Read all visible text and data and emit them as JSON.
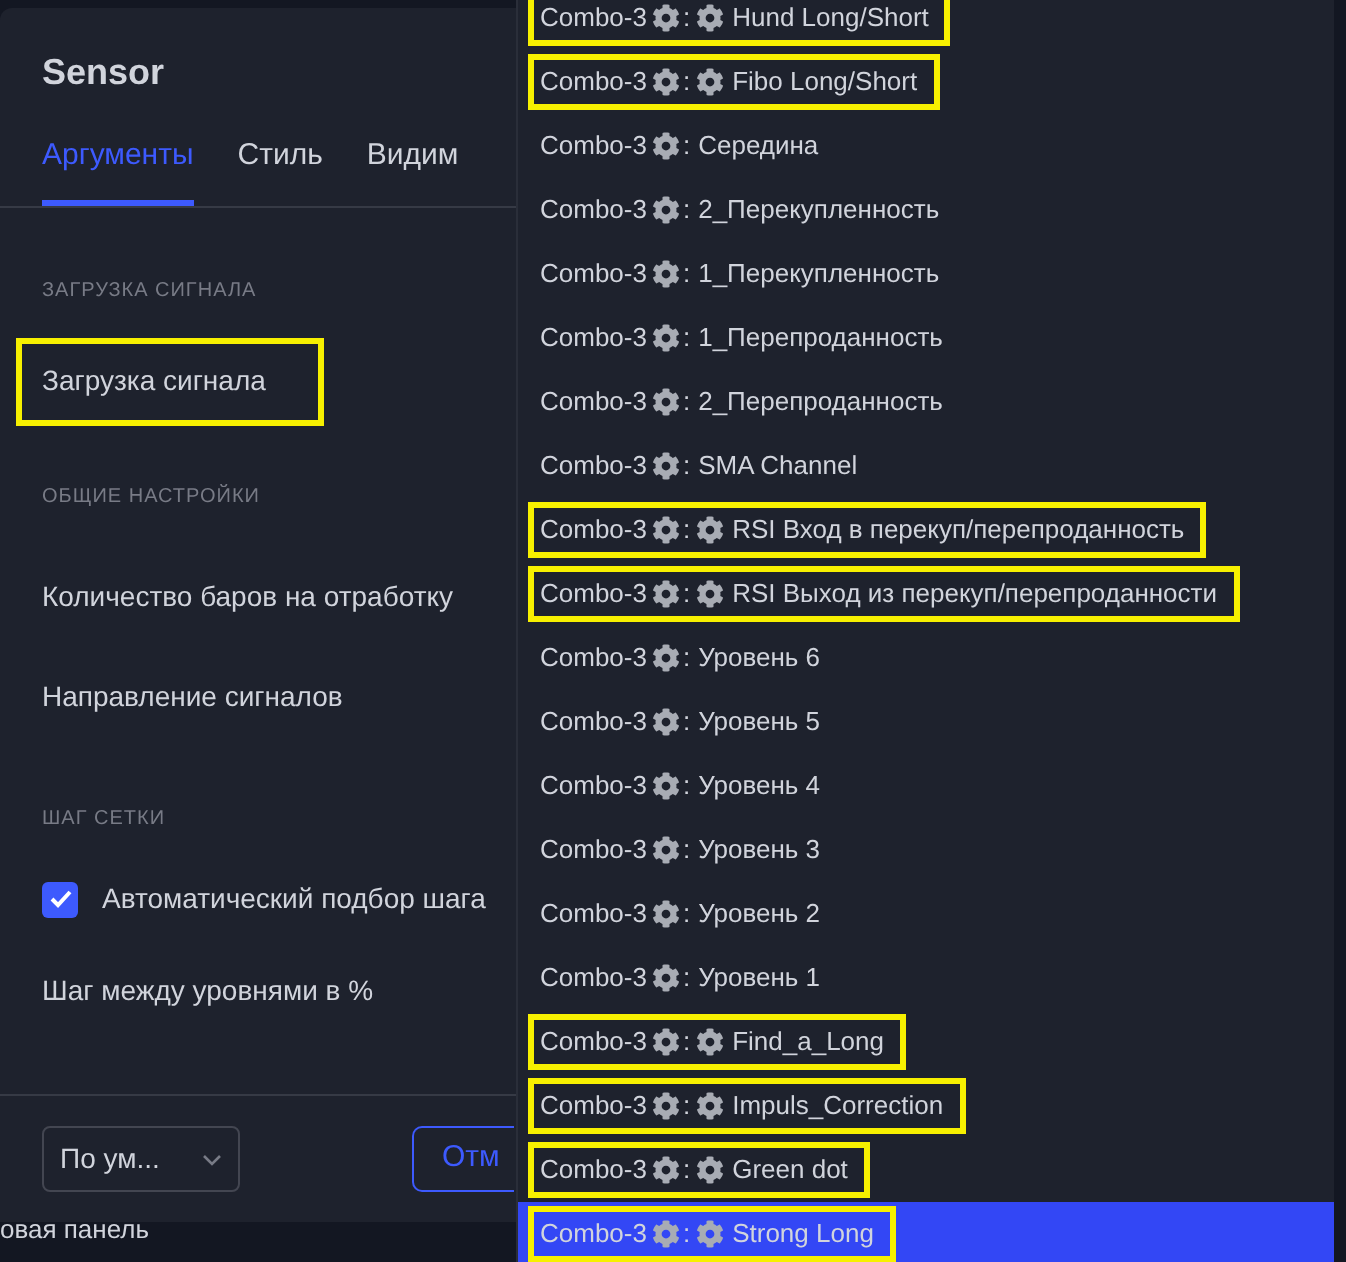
{
  "dialog": {
    "title": "Sensor",
    "tabs": [
      {
        "label": "Аргументы",
        "selected": true
      },
      {
        "label": "Стиль",
        "selected": false
      },
      {
        "label": "Видим",
        "selected": false
      }
    ],
    "sections": [
      {
        "heading": "ЗАГРУЗКА СИГНАЛА",
        "rows": [
          {
            "kind": "field",
            "label": "Загрузка сигнала",
            "highlighted": true
          }
        ]
      },
      {
        "heading": "ОБЩИЕ НАСТРОЙКИ",
        "rows": [
          {
            "kind": "field",
            "label": "Количество баров на отработку",
            "highlighted": false
          },
          {
            "kind": "field",
            "label": "Направление сигналов",
            "highlighted": false
          }
        ]
      },
      {
        "heading": "ШАГ СЕТКИ",
        "rows": [
          {
            "kind": "checkbox",
            "label": "Автоматический подбор шага",
            "checked": true,
            "highlighted": false
          },
          {
            "kind": "field",
            "label": "Шаг между уровнями в %",
            "highlighted": false
          }
        ]
      }
    ],
    "footer": {
      "template_select": "По ум...",
      "cancel_button": "Отм"
    }
  },
  "background_panel_text": "овая панель",
  "dropdown": {
    "options": [
      {
        "source": "Combo-3",
        "separator": ":",
        "label": "Hund Long/Short",
        "label_icon": true,
        "highlighted": true,
        "selected": false
      },
      {
        "source": "Combo-3",
        "separator": ":",
        "label": "Fibo Long/Short",
        "label_icon": true,
        "highlighted": true,
        "selected": false
      },
      {
        "source": "Combo-3",
        "separator": ":",
        "label": "Середина",
        "label_icon": false,
        "highlighted": false,
        "selected": false
      },
      {
        "source": "Combo-3",
        "separator": ":",
        "label": "2_Перекупленность",
        "label_icon": false,
        "highlighted": false,
        "selected": false
      },
      {
        "source": "Combo-3",
        "separator": ":",
        "label": "1_Перекупленность",
        "label_icon": false,
        "highlighted": false,
        "selected": false
      },
      {
        "source": "Combo-3",
        "separator": ":",
        "label": "1_Перепроданность",
        "label_icon": false,
        "highlighted": false,
        "selected": false
      },
      {
        "source": "Combo-3",
        "separator": ":",
        "label": "2_Перепроданность",
        "label_icon": false,
        "highlighted": false,
        "selected": false
      },
      {
        "source": "Combo-3",
        "separator": ":",
        "label": "SMA Channel",
        "label_icon": false,
        "highlighted": false,
        "selected": false
      },
      {
        "source": "Combo-3",
        "separator": ":",
        "label": "RSI Вход в перекуп/перепроданность",
        "label_icon": true,
        "highlighted": true,
        "selected": false
      },
      {
        "source": "Combo-3",
        "separator": ":",
        "label": "RSI Выход из перекуп/перепроданности",
        "label_icon": true,
        "highlighted": true,
        "selected": false
      },
      {
        "source": "Combo-3",
        "separator": ":",
        "label": "Уровень 6",
        "label_icon": false,
        "highlighted": false,
        "selected": false
      },
      {
        "source": "Combo-3",
        "separator": ":",
        "label": "Уровень 5",
        "label_icon": false,
        "highlighted": false,
        "selected": false
      },
      {
        "source": "Combo-3",
        "separator": ":",
        "label": "Уровень 4",
        "label_icon": false,
        "highlighted": false,
        "selected": false
      },
      {
        "source": "Combo-3",
        "separator": ":",
        "label": "Уровень 3",
        "label_icon": false,
        "highlighted": false,
        "selected": false
      },
      {
        "source": "Combo-3",
        "separator": ":",
        "label": "Уровень 2",
        "label_icon": false,
        "highlighted": false,
        "selected": false
      },
      {
        "source": "Combo-3",
        "separator": ":",
        "label": "Уровень 1",
        "label_icon": false,
        "highlighted": false,
        "selected": false
      },
      {
        "source": "Combo-3",
        "separator": ":",
        "label": "Find_a_Long",
        "label_icon": true,
        "highlighted": true,
        "selected": false
      },
      {
        "source": "Combo-3",
        "separator": ":",
        "label": "Impuls_Correction",
        "label_icon": true,
        "highlighted": true,
        "selected": false
      },
      {
        "source": "Combo-3",
        "separator": ":",
        "label": "Green dot",
        "label_icon": true,
        "highlighted": true,
        "selected": false
      },
      {
        "source": "Combo-3",
        "separator": ":",
        "label": "Strong Long",
        "label_icon": true,
        "highlighted": true,
        "selected": true
      }
    ]
  }
}
